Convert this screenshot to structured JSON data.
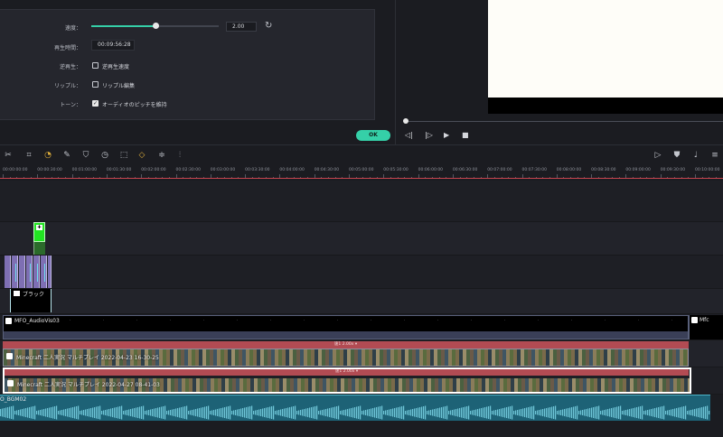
{
  "speed": {
    "speed_label": "速度：",
    "speed_value": "2.00",
    "speed_fraction": 0.5,
    "reset_icon": "reset-icon",
    "duration_label": "再生時間：",
    "duration_value": "00:09:56:28",
    "reverse_label": "逆再生：",
    "reverse_option": "逆再生速度",
    "reverse_checked": false,
    "ripple_label": "リップル：",
    "ripple_option": "リップル編集",
    "ripple_checked": false,
    "tone_label": "トーン：",
    "tone_option": "オーディオのピッチを維持",
    "tone_checked": true,
    "ok_label": "OK",
    "accent": "#35d0a8"
  },
  "preview": {
    "controls": [
      "step-back-icon",
      "play-frame-icon",
      "play-icon",
      "stop-icon"
    ]
  },
  "toolbar": {
    "left_icons": [
      "scissors-icon",
      "crop-icon",
      "speed-icon",
      "color-icon",
      "stabilize-icon",
      "timer-icon",
      "freeze-frame-icon",
      "keyframe-icon",
      "adjust-icon",
      "audio-icon"
    ],
    "right_icons": [
      "render-icon",
      "shield-icon",
      "mic-icon",
      "menu-icon"
    ]
  },
  "ruler": {
    "ticks": [
      "00:00:00:00",
      "00:00:30:00",
      "00:01:00:00",
      "00:01:30:00",
      "00:02:00:00",
      "00:02:30:00",
      "00:03:00:00",
      "00:03:30:00",
      "00:04:00:00",
      "00:04:30:00",
      "00:05:00:00",
      "00:05:30:00",
      "00:06:00:00",
      "00:06:30:00",
      "00:07:00:00",
      "00:07:30:00",
      "00:08:00:00",
      "00:08:30:00",
      "00:09:00:00",
      "00:09:30:00",
      "00:10:00:00",
      "00:10:30:00"
    ]
  },
  "tracks": {
    "black_clip": "ブラック",
    "audiovis_clip": "MFO_AudioVis03",
    "audiovis_clip2": "Mfc",
    "speed_bar_1": "速1 2.00x",
    "video_clip_1": "Minecraft 二人実況 マルチプレイ 2022-04-23 16-30-25",
    "speed_bar_2": "速1 2.00x",
    "video_clip_2": "Minecraft 二人実況 マルチプレイ 2022-04-27 08-41-03",
    "bgm_clip": "O_BGM02",
    "clip_color": "#b24b53",
    "bgm_color": "#1d6276"
  }
}
